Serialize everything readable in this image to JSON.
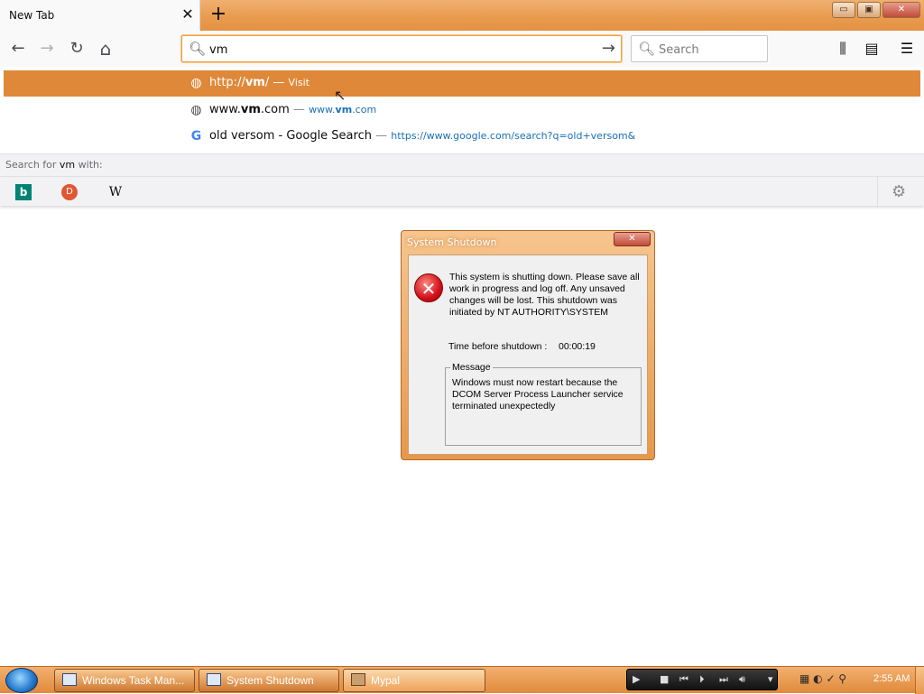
{
  "browser": {
    "tab_title": "New Tab",
    "tab_close": "✕",
    "new_tab": "+",
    "window_buttons": {
      "minimize": "▭",
      "maximize": "▣",
      "close": "✕"
    },
    "nav": {
      "back": "←",
      "forward": "→",
      "reload": "↻",
      "home": "⌂"
    },
    "url_value": "vm",
    "go": "→",
    "search_placeholder": "Search",
    "toolbar_icons": {
      "library": "⫼",
      "sidebar": "▤",
      "menu": "☰"
    }
  },
  "suggestions": [
    {
      "icon": "globe-icon",
      "glyph": "◍",
      "prefix": "http://",
      "bold": "vm",
      "suffix": "/",
      "action": "Visit"
    },
    {
      "icon": "globe-icon",
      "glyph": "◍",
      "prefix": "www.",
      "bold": "vm",
      "suffix": ".com",
      "url_prefix": "www.",
      "url_bold": "vm",
      "url_suffix": ".com"
    },
    {
      "icon": "google-icon",
      "glyph": "G",
      "title": "old versom - Google Search",
      "url": "https://www.google.com/search?q=old+versom&"
    }
  ],
  "search_with": {
    "label": "Search for ",
    "term": "vm",
    "suffix": " with:"
  },
  "engines": {
    "bing": "b",
    "ddg": "D",
    "wiki": "W",
    "settings": "⚙"
  },
  "dialog": {
    "title": "System Shutdown",
    "close": "✕",
    "message": "This system is shutting down. Please save all work in progress and log off. Any unsaved changes will be lost. This shutdown was initiated by NT AUTHORITY\\SYSTEM",
    "time_label": "Time before shutdown :",
    "time_value": "00:00:19",
    "message_group_label": "Message",
    "message_group_text": "Windows must now restart because the DCOM Server Process Launcher service terminated unexpectedly"
  },
  "taskbar": {
    "items": [
      "Windows Task Man...",
      "System Shutdown",
      "Mypal"
    ],
    "clock": "2:55 AM"
  }
}
